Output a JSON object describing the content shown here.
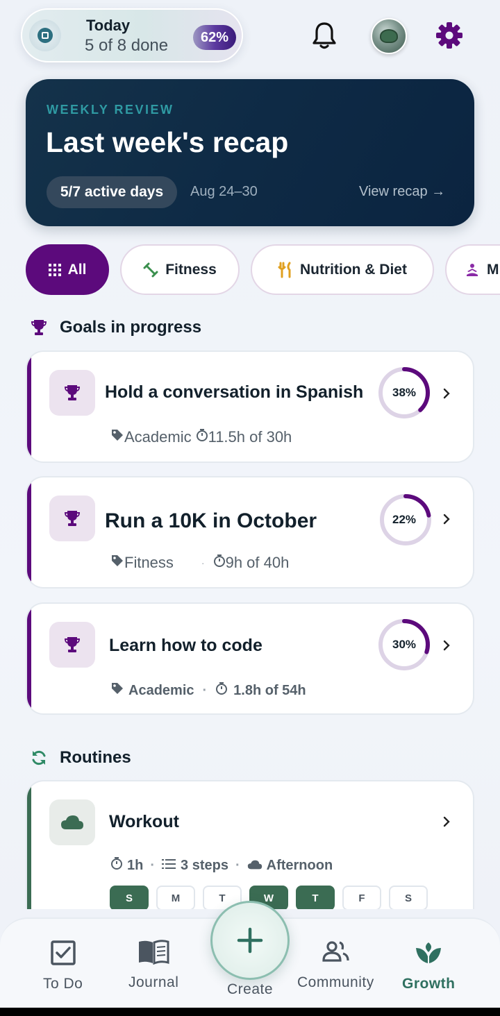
{
  "today": {
    "title": "Today",
    "subtitle": "5 of 8 done",
    "percent": "62%",
    "progress_fraction": 0.62
  },
  "weekly_review": {
    "eyebrow": "WEEKLY REVIEW",
    "title": "Last week's recap",
    "active_days": "5/7 active days",
    "date_range": "Aug 24–30",
    "link": "View recap →"
  },
  "filters": [
    {
      "label": "All",
      "icon": "grid-icon",
      "active": true
    },
    {
      "label": "Fitness",
      "icon": "dumbbell-icon",
      "active": false
    },
    {
      "label": "Nutrition & Diet",
      "icon": "fork-knife-icon",
      "active": false
    },
    {
      "label": "M",
      "icon": "meditation-icon",
      "active": false
    }
  ],
  "goals_section": {
    "title": "Goals in progress",
    "icon": "trophy-icon"
  },
  "goals": [
    {
      "title": "Hold a conversation in Spanish",
      "category": "Academic",
      "time": "11.5h of 30h",
      "percent": "38%",
      "progress": 0.38
    },
    {
      "title": "Run a 10K in October",
      "category": "Fitness",
      "separator": "·",
      "time": "9h of 40h",
      "percent": "22%",
      "progress": 0.22
    },
    {
      "title": "Learn how to code",
      "category": "Academic",
      "separator": "·",
      "time": "1.8h of 54h",
      "percent": "30%",
      "progress": 0.3
    }
  ],
  "routines_section": {
    "title": "Routines",
    "icon": "refresh-icon"
  },
  "routine": {
    "title": "Workout",
    "duration": "1h",
    "steps": "3 steps",
    "time_of_day": "Afternoon",
    "sep": "·",
    "days": [
      {
        "label": "S",
        "on": true
      },
      {
        "label": "M",
        "on": false
      },
      {
        "label": "T",
        "on": false
      },
      {
        "label": "W",
        "on": true
      },
      {
        "label": "T",
        "on": true
      },
      {
        "label": "F",
        "on": false
      },
      {
        "label": "S",
        "on": false
      }
    ]
  },
  "nav": {
    "todo": "To Do",
    "journal": "Journal",
    "create": "Create",
    "community": "Community",
    "growth": "Growth",
    "active": "Growth"
  },
  "colors": {
    "accent_purple": "#5c0a7c",
    "routine_green": "#3b6c53",
    "review_bg": "#0e2a45",
    "growth_green": "#2f7060"
  }
}
